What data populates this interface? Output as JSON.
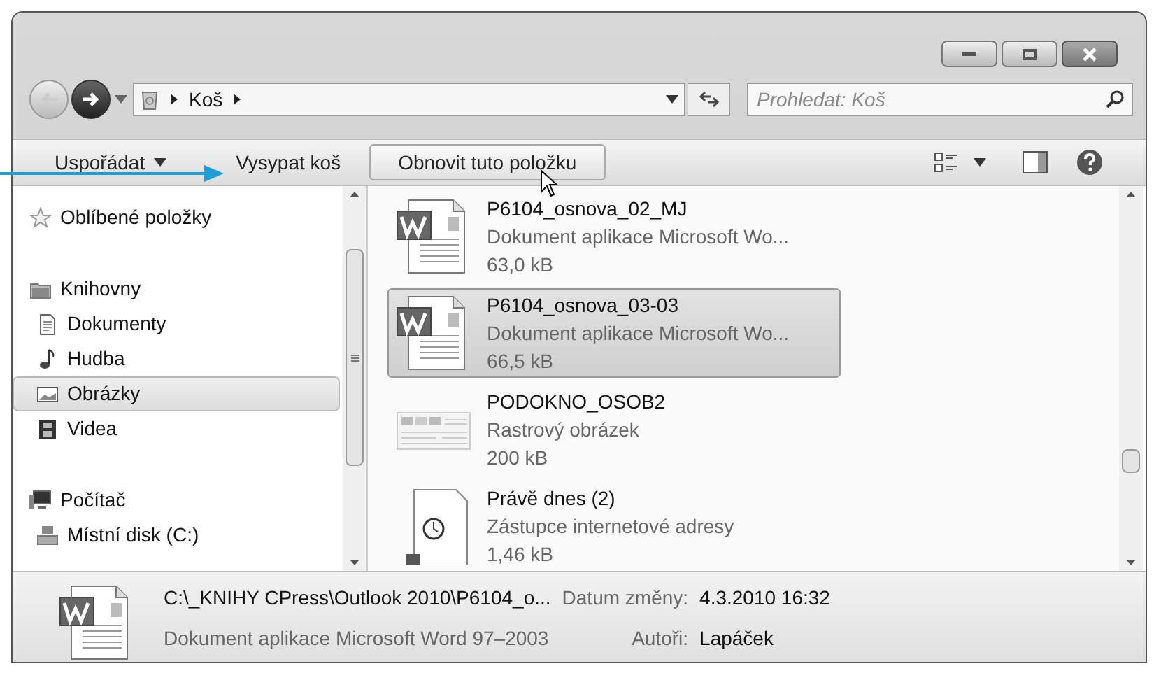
{
  "address": {
    "crumbs": [
      "Koš"
    ]
  },
  "search": {
    "placeholder": "Prohledat: Koš"
  },
  "toolbar": {
    "organize": "Uspořádat",
    "buttons": [
      {
        "label": "Vysypat koš",
        "hover": false
      },
      {
        "label": "Obnovit tuto položku",
        "hover": true
      }
    ]
  },
  "navigation": [
    {
      "label": "Oblíbené položky",
      "kind": "star",
      "selected": false
    },
    {
      "label": "Knihovny",
      "kind": "library",
      "selected": false,
      "children": [
        {
          "label": "Dokumenty",
          "kind": "document",
          "selected": false
        },
        {
          "label": "Hudba",
          "kind": "music",
          "selected": false
        },
        {
          "label": "Obrázky",
          "kind": "picture",
          "selected": true
        },
        {
          "label": "Videa",
          "kind": "video",
          "selected": false
        }
      ]
    },
    {
      "label": "Počítač",
      "kind": "computer",
      "selected": false,
      "children": [
        {
          "label": "Místní disk (C:)",
          "kind": "disk",
          "selected": false
        }
      ]
    }
  ],
  "files": [
    {
      "name": "P6104_osnova_02_MJ",
      "type": "Dokument aplikace Microsoft Wo...",
      "size": "63,0 kB",
      "kind": "word",
      "selected": false
    },
    {
      "name": "P6104_osnova_03-03",
      "type": "Dokument aplikace Microsoft Wo...",
      "size": "66,5 kB",
      "kind": "word",
      "selected": true
    },
    {
      "name": "PODOKNO_OSOB2",
      "type": "Rastrový obrázek",
      "size": "200 kB",
      "kind": "image",
      "selected": false
    },
    {
      "name": "Právě dnes (2)",
      "type": "Zástupce internetové adresy",
      "size": "1,46 kB",
      "kind": "shortcut",
      "selected": false
    }
  ],
  "details": {
    "path": "C:\\_KNIHY CPress\\Outlook 2010\\P6104_o...",
    "type": "Dokument aplikace Microsoft Word 97–2003",
    "fields": [
      {
        "label": "Datum změny:",
        "value": "4.3.2010 16:32"
      },
      {
        "label": "Autoři:",
        "value": "Lapáček"
      }
    ]
  }
}
